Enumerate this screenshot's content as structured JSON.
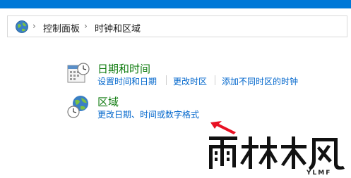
{
  "breadcrumb": {
    "separator": "›",
    "items": [
      "控制面板",
      "时钟和区域"
    ]
  },
  "categories": [
    {
      "icon": "calendar-clock-icon",
      "title": "日期和时间",
      "links": [
        "设置时间和日期",
        "更改时区",
        "添加不同时区的时钟"
      ]
    },
    {
      "icon": "globe-clock-icon",
      "title": "区域",
      "links": [
        "更改日期、时间或数字格式"
      ]
    }
  ],
  "watermark": {
    "logo_text": "雨林木风",
    "sub_text": "YLMF"
  },
  "colors": {
    "title_bar": "#0078d7",
    "heading": "#107c10",
    "link": "#0066cc",
    "arrow": "#e81123"
  }
}
